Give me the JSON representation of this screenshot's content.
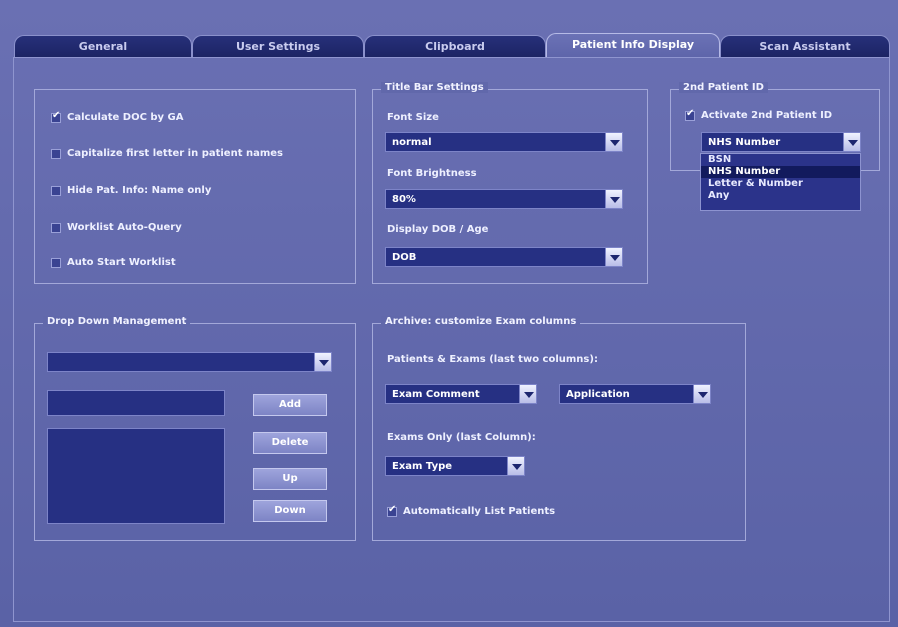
{
  "tabs": [
    {
      "label": "General"
    },
    {
      "label": "User Settings"
    },
    {
      "label": "Clipboard"
    },
    {
      "label": "Patient Info Display"
    },
    {
      "label": "Scan Assistant"
    }
  ],
  "general_options": [
    {
      "label": "Calculate DOC by GA",
      "checked": true
    },
    {
      "label": "Capitalize first letter in patient names",
      "checked": false
    },
    {
      "label": "Hide Pat. Info: Name only",
      "checked": false
    },
    {
      "label": "Worklist Auto-Query",
      "checked": false
    },
    {
      "label": "Auto Start Worklist",
      "checked": false
    }
  ],
  "title_bar": {
    "legend": "Title Bar Settings",
    "font_size_label": "Font Size",
    "font_size_value": "normal",
    "font_brightness_label": "Font Brightness",
    "font_brightness_value": "80%",
    "display_dob_label": "Display DOB / Age",
    "display_dob_value": "DOB"
  },
  "second_id": {
    "legend": "2nd Patient ID",
    "activate_label": "Activate 2nd Patient ID",
    "activate_checked": true,
    "selected": "NHS Number",
    "options": [
      "BSN",
      "NHS Number",
      "Letter & Number",
      "Any"
    ]
  },
  "dropdown_mgmt": {
    "legend": "Drop Down Management",
    "add": "Add",
    "delete": "Delete",
    "up": "Up",
    "down": "Down"
  },
  "archive": {
    "legend": "Archive: customize Exam columns",
    "two_columns_label": "Patients & Exams (last two columns):",
    "col1_value": "Exam Comment",
    "col2_value": "Application",
    "exams_only_label": "Exams Only (last Column):",
    "exams_only_value": "Exam Type",
    "auto_list_label": "Automatically List Patients",
    "auto_list_checked": true
  }
}
